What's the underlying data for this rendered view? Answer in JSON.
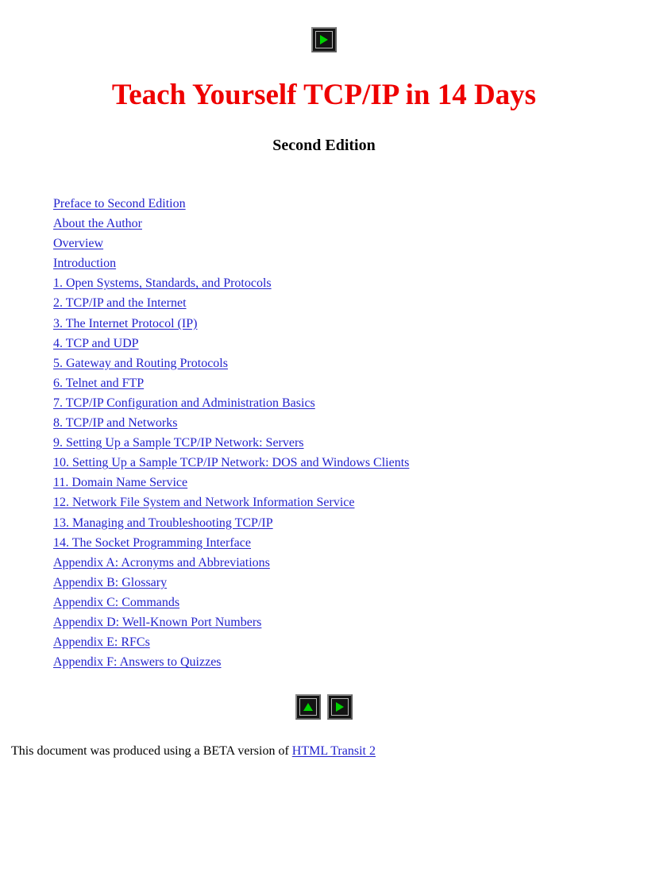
{
  "document": {
    "title": "Teach Yourself TCP/IP in 14 Days",
    "subtitle": "Second Edition",
    "title_color": "#ee0000",
    "link_color": "#2222cc",
    "background_color": "#ffffff"
  },
  "top_nav": {
    "next_button": {
      "icon": "triangle-right-icon",
      "glyph_color": "#00d200"
    }
  },
  "toc": {
    "items": [
      {
        "label": "Preface to Second Edition"
      },
      {
        "label": "About the Author"
      },
      {
        "label": "Overview"
      },
      {
        "label": "Introduction"
      },
      {
        "label": " 1. Open Systems, Standards, and Protocols"
      },
      {
        "label": " 2. TCP/IP and the Internet"
      },
      {
        "label": " 3. The Internet Protocol (IP)"
      },
      {
        "label": " 4. TCP and UDP"
      },
      {
        "label": " 5. Gateway and Routing Protocols"
      },
      {
        "label": " 6. Telnet and FTP"
      },
      {
        "label": " 7. TCP/IP Configuration and Administration Basics"
      },
      {
        "label": " 8. TCP/IP and Networks"
      },
      {
        "label": " 9. Setting Up a Sample TCP/IP Network: Servers"
      },
      {
        "label": "10. Setting Up a Sample TCP/IP Network: DOS and Windows Clients"
      },
      {
        "label": "11. Domain Name Service"
      },
      {
        "label": "12. Network File System and Network Information Service"
      },
      {
        "label": "13. Managing and Troubleshooting TCP/IP"
      },
      {
        "label": "14. The Socket Programming Interface"
      },
      {
        "label": "Appendix A: Acronyms and Abbreviations"
      },
      {
        "label": "Appendix B: Glossary"
      },
      {
        "label": "Appendix C: Commands"
      },
      {
        "label": "Appendix D: Well-Known Port Numbers"
      },
      {
        "label": "Appendix E: RFCs"
      },
      {
        "label": "Appendix F: Answers to Quizzes"
      }
    ]
  },
  "bottom_nav": {
    "up_button": {
      "icon": "triangle-up-icon",
      "glyph_color": "#00d200"
    },
    "next_button": {
      "icon": "triangle-right-icon",
      "glyph_color": "#00d200"
    }
  },
  "footer": {
    "text": "This document was produced using a BETA version of ",
    "link_label": "HTML Transit 2"
  }
}
